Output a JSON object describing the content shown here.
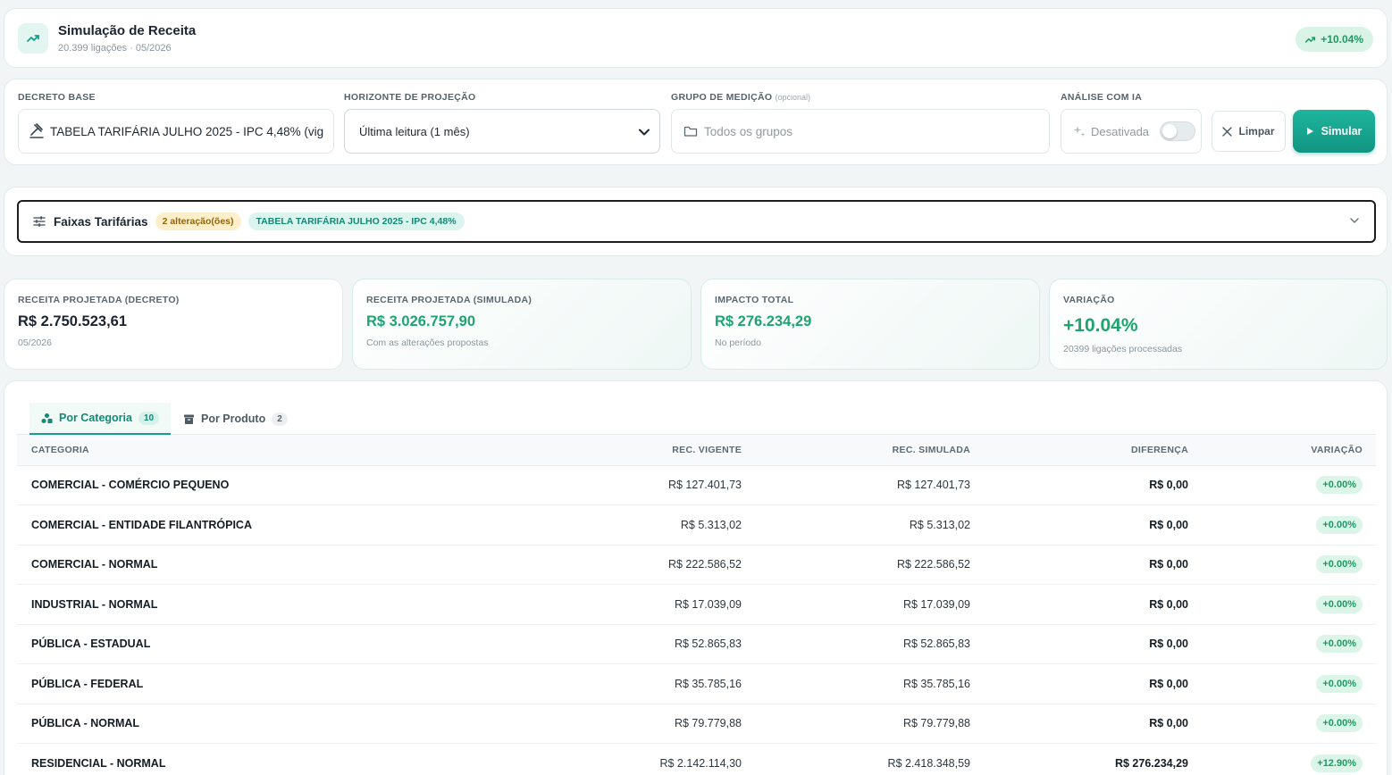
{
  "header": {
    "title": "Simulação de Receita",
    "subtitle": "20.399 ligações · 05/2026",
    "badge": "+10.04%"
  },
  "controls": {
    "decreto_label": "DECRETO BASE",
    "decreto_value": "TABELA TARIFÁRIA JULHO 2025 - IPC 4,48% (vig",
    "horizonte_label": "HORIZONTE DE PROJEÇÃO",
    "horizonte_value": "Última leitura (1 mês)",
    "grupo_label": "GRUPO DE MEDIÇÃO",
    "grupo_optional": "(opcional)",
    "grupo_placeholder": "Todos os grupos",
    "ia_label": "ANÁLISE COM IA",
    "ia_value": "Desativada",
    "ia_enabled": false,
    "clear_label": "Limpar",
    "simulate_label": "Simular"
  },
  "faixas": {
    "title": "Faixas Tarifárias",
    "changes_badge": "2 alteração(ões)",
    "decreto_badge": "TABELA TARIFÁRIA JULHO 2025 - IPC 4,48%"
  },
  "kpis": {
    "decreto": {
      "label": "RECEITA PROJETADA (DECRETO)",
      "value": "R$ 2.750.523,61",
      "sub": "05/2026"
    },
    "simulada": {
      "label": "RECEITA PROJETADA (SIMULADA)",
      "value": "R$ 3.026.757,90",
      "sub": "Com as alterações propostas"
    },
    "impacto": {
      "label": "IMPACTO TOTAL",
      "value": "R$ 276.234,29",
      "sub": "No período"
    },
    "variacao": {
      "label": "VARIAÇÃO",
      "value": "+10.04%",
      "sub": "20399 ligações processadas"
    }
  },
  "tabs": [
    {
      "label": "Por Categoria",
      "count": "10"
    },
    {
      "label": "Por Produto",
      "count": "2"
    }
  ],
  "table": {
    "headers": [
      "CATEGORIA",
      "REC. VIGENTE",
      "REC. SIMULADA",
      "DIFERENÇA",
      "VARIAÇÃO"
    ],
    "rows": [
      [
        "COMERCIAL - COMÉRCIO PEQUENO",
        "R$ 127.401,73",
        "R$ 127.401,73",
        "R$ 0,00",
        "+0.00%"
      ],
      [
        "COMERCIAL - ENTIDADE FILANTRÓPICA",
        "R$ 5.313,02",
        "R$ 5.313,02",
        "R$ 0,00",
        "+0.00%"
      ],
      [
        "COMERCIAL - NORMAL",
        "R$ 222.586,52",
        "R$ 222.586,52",
        "R$ 0,00",
        "+0.00%"
      ],
      [
        "INDUSTRIAL - NORMAL",
        "R$ 17.039,09",
        "R$ 17.039,09",
        "R$ 0,00",
        "+0.00%"
      ],
      [
        "PÚBLICA - ESTADUAL",
        "R$ 52.865,83",
        "R$ 52.865,83",
        "R$ 0,00",
        "+0.00%"
      ],
      [
        "PÚBLICA - FEDERAL",
        "R$ 35.785,16",
        "R$ 35.785,16",
        "R$ 0,00",
        "+0.00%"
      ],
      [
        "PÚBLICA - NORMAL",
        "R$ 79.779,88",
        "R$ 79.779,88",
        "R$ 0,00",
        "+0.00%"
      ],
      [
        "RESIDENCIAL - NORMAL",
        "R$ 2.142.114,30",
        "R$ 2.418.348,59",
        "R$ 276.234,29",
        "+12.90%"
      ]
    ]
  },
  "colors": {
    "accent": "#13a08b",
    "positive": "#1ea46f",
    "background": "#f1f5f5"
  },
  "icons": {
    "header": "trending-up-icon",
    "decreto": "gavel-icon",
    "grupo": "folder-icon",
    "ia": "sparkle-icon",
    "clear": "close-icon",
    "simulate": "play-icon",
    "faixas": "sliders-icon",
    "tab_categoria": "shapes-icon",
    "tab_produto": "box-icon"
  }
}
